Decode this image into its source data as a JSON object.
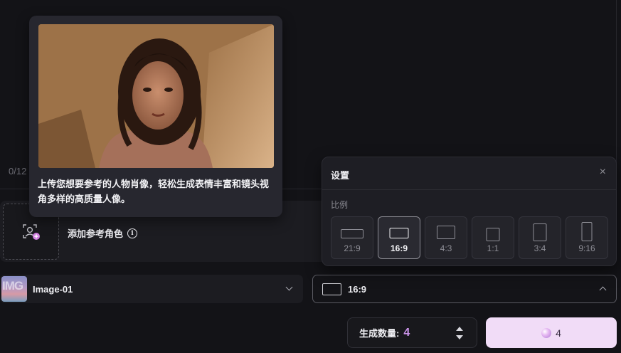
{
  "prompt": {
    "char_count": "0/12"
  },
  "reference": {
    "add_label": "添加参考角色",
    "info_icon": "info-icon"
  },
  "tooltip": {
    "text": "上传您想要参考的人物肖像，轻松生成表情丰富和镜头视角多样的高质量人像。"
  },
  "model": {
    "name": "Image-01",
    "thumb_text": "IMG"
  },
  "ratio_select": {
    "value": "16:9"
  },
  "settings": {
    "title": "设置",
    "close": "×",
    "ratio_label": "比例",
    "ratios": [
      {
        "label": "21:9",
        "active": false
      },
      {
        "label": "16:9",
        "active": true
      },
      {
        "label": "4:3",
        "active": false
      },
      {
        "label": "1:1",
        "active": false
      },
      {
        "label": "3:4",
        "active": false
      },
      {
        "label": "9:16",
        "active": false
      }
    ]
  },
  "quantity": {
    "label": "生成数量:",
    "value": "4"
  },
  "generate": {
    "cost": "4"
  },
  "colors": {
    "accent": "#c993e8",
    "generate_bg": "#f1dcf7"
  }
}
